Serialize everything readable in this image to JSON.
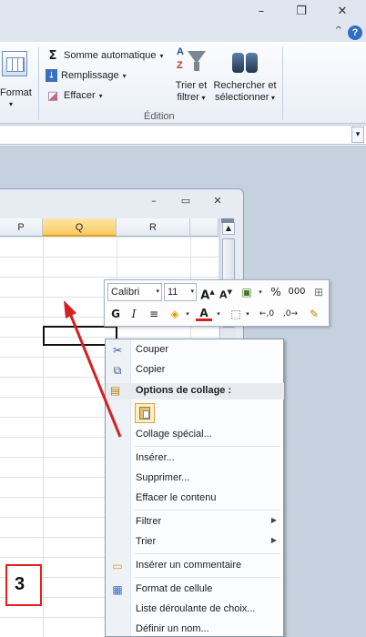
{
  "window": {
    "minimize": "–",
    "restore": "❐",
    "close": "✕",
    "help": "?",
    "collapse": "^"
  },
  "ribbon": {
    "format_label": "Format",
    "editing": {
      "autosum": "Somme automatique",
      "fill": "Remplissage",
      "clear": "Effacer",
      "sort_filter_line1": "Trier et",
      "sort_filter_line2": "filtrer",
      "find_select_line1": "Rechercher et",
      "find_select_line2": "sélectionner",
      "group_label": "Édition"
    }
  },
  "workbook": {
    "buttons": {
      "minimize": "–",
      "restore": "▭",
      "close": "✕"
    },
    "columns": [
      "P",
      "Q",
      "R"
    ],
    "selected_column": "Q"
  },
  "mini_toolbar": {
    "font": "Calibri",
    "size": "11",
    "grow": "A",
    "shrink": "A",
    "percent": "%",
    "thousands": "000",
    "bold": "G",
    "italic": "I"
  },
  "context_menu": {
    "cut": "Couper",
    "copy": "Copier",
    "paste_options": "Options de collage :",
    "paste_special": "Collage spécial...",
    "insert": "Insérer...",
    "delete": "Supprimer...",
    "clear_contents": "Effacer le contenu",
    "filter": "Filtrer",
    "sort": "Trier",
    "insert_comment": "Insérer un commentaire",
    "format_cells": "Format de cellule",
    "dropdown_list": "Liste déroulante de choix...",
    "define_name": "Définir un nom..."
  },
  "annotation": {
    "step": "3"
  },
  "colors": {
    "arrow": "#d42020",
    "selected_header": "#f9c965"
  }
}
